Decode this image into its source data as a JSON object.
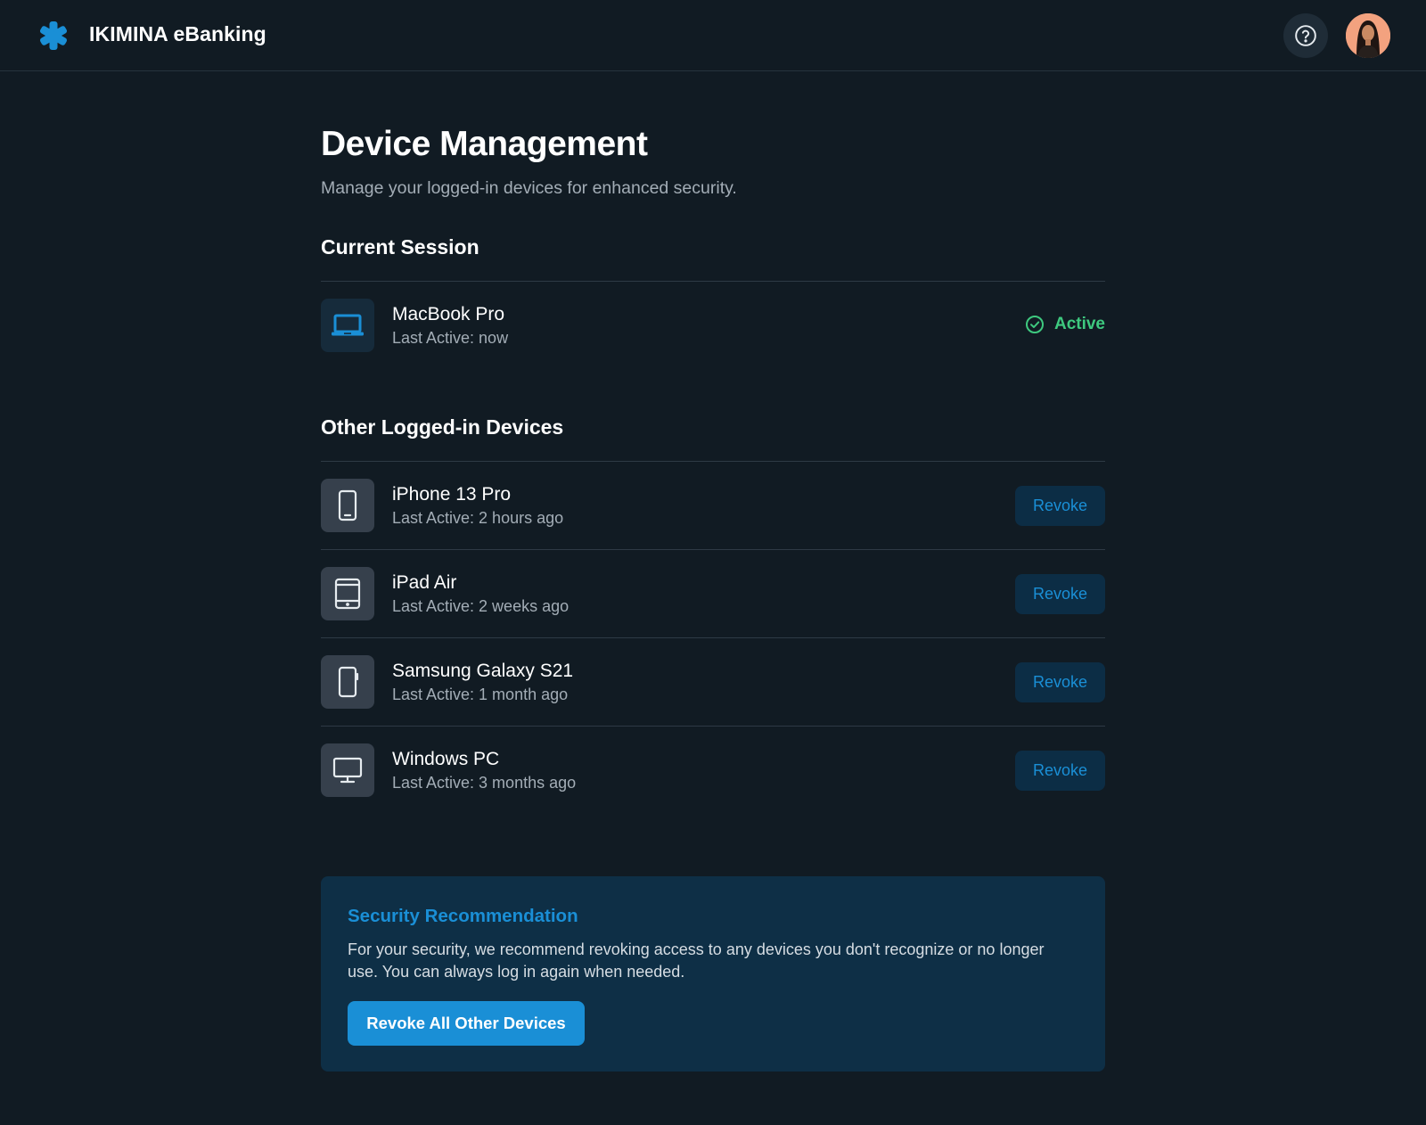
{
  "app": {
    "brand": "IKIMINA eBanking"
  },
  "header": {
    "help_icon": "question-circle-icon",
    "avatar_icon": "user-avatar"
  },
  "page": {
    "title": "Device Management",
    "subtitle": "Manage your logged-in devices for enhanced security."
  },
  "current_session": {
    "heading": "Current Session",
    "device": {
      "name": "MacBook Pro",
      "last_active": "Last Active: now",
      "icon": "laptop-icon",
      "status": "Active"
    }
  },
  "other_devices": {
    "heading": "Other Logged-in Devices",
    "revoke_label": "Revoke",
    "items": [
      {
        "name": "iPhone 13 Pro",
        "last_active": "Last Active: 2 hours ago",
        "icon": "smartphone-icon"
      },
      {
        "name": "iPad Air",
        "last_active": "Last Active: 2 weeks ago",
        "icon": "tablet-icon"
      },
      {
        "name": "Samsung Galaxy S21",
        "last_active": "Last Active: 1 month ago",
        "icon": "smartphone-icon"
      },
      {
        "name": "Windows PC",
        "last_active": "Last Active: 3 months ago",
        "icon": "desktop-icon"
      }
    ]
  },
  "recommendation": {
    "title": "Security Recommendation",
    "text": "For your security, we recommend revoking access to any devices you don't recognize or no longer use. You can always log in again when needed.",
    "button_label": "Revoke All Other Devices"
  },
  "colors": {
    "background": "#111b23",
    "accent": "#1a8fd6",
    "active_green": "#3ec97f",
    "card": "#0e2f46"
  }
}
